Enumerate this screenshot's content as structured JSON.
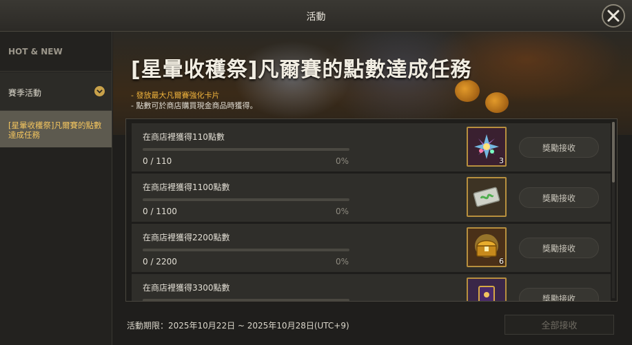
{
  "window": {
    "title": "活動"
  },
  "sidebar": {
    "items": [
      {
        "label": "HOT & NEW"
      },
      {
        "label": "賽季活動"
      },
      {
        "label": "[星暈收穫祭]凡爾賽的點數達成任務"
      }
    ]
  },
  "banner": {
    "title": "[星暈收穫祭]凡爾賽的點數達成任務",
    "desc1": "- 發放最大凡爾賽強化卡片",
    "desc2": "- 點數可於商店購買現金商品時獲得。"
  },
  "missions": [
    {
      "name": "在商店裡獲得110點數",
      "progress": "0 / 110",
      "percent": "0%",
      "progress_value": 0,
      "reward_icon": "crystal-flower-icon",
      "reward_qty": "3",
      "claim_label": "獎勵接收"
    },
    {
      "name": "在商店裡獲得1100點數",
      "progress": "0 / 1100",
      "percent": "0%",
      "progress_value": 0,
      "reward_icon": "ticket-icon",
      "reward_qty": "",
      "claim_label": "獎勵接收"
    },
    {
      "name": "在商店裡獲得2200點數",
      "progress": "0 / 2200",
      "percent": "0%",
      "progress_value": 0,
      "reward_icon": "treasure-chest-icon",
      "reward_qty": "6",
      "claim_label": "獎勵接收"
    },
    {
      "name": "在商店裡獲得3300點數",
      "progress": "",
      "percent": "",
      "progress_value": 0,
      "reward_icon": "card-icon",
      "reward_qty": "",
      "claim_label": "獎勵接收"
    }
  ],
  "footer": {
    "period": "活動期限：2025年10月22日 ~ 2025年10月28日(UTC+9)",
    "claim_all_label": "全部接收"
  },
  "colors": {
    "accent": "#f3c55f",
    "reward_border": "#b8903e",
    "desc_highlight": "#f0b33c"
  }
}
